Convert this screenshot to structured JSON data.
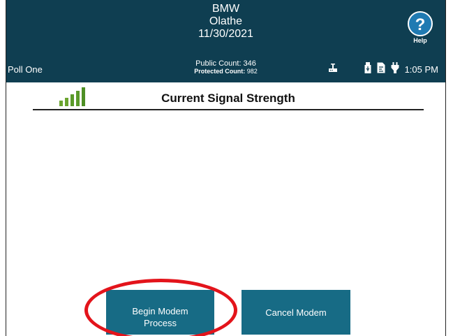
{
  "header": {
    "title_line1": "BMW",
    "title_line2": "Olathe",
    "title_line3": "11/30/2021",
    "poll_name": "Poll One",
    "public_count": "Public Count: 346",
    "protected_count_label": "Protected Count:",
    "protected_count_value": "982",
    "time": "1:05 PM",
    "help_label": "Help",
    "help_symbol": "?",
    "icons": [
      "modem-icon",
      "usb-drive-icon",
      "document-icon",
      "power-plug-icon"
    ]
  },
  "signal": {
    "title": "Current Signal Strength",
    "level_bars": 5,
    "bar_color": "#5a9a2a"
  },
  "buttons": {
    "begin_label_line1": "Begin Modem",
    "begin_label_line2": "Process",
    "cancel_label": "Cancel Modem"
  },
  "colors": {
    "header_bg": "#0f3e51",
    "button_bg": "#176b85",
    "help_bg": "#1f7ab2",
    "highlight": "#e3141b"
  }
}
